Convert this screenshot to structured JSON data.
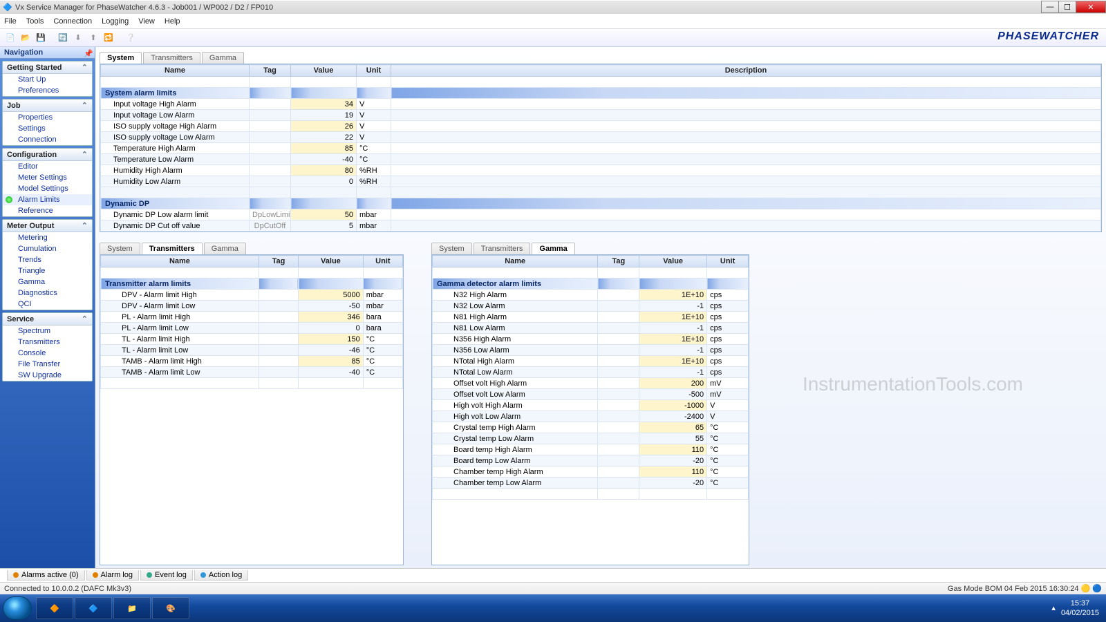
{
  "window": {
    "title": "Vx Service Manager for PhaseWatcher 4.6.3 - Job001 / WP002 / D2 / FP010"
  },
  "menu": [
    "File",
    "Tools",
    "Connection",
    "Logging",
    "View",
    "Help"
  ],
  "brand": "PHASEWATCHER",
  "nav": {
    "title": "Navigation",
    "panels": [
      {
        "title": "Getting Started",
        "items": [
          "Start Up",
          "Preferences"
        ]
      },
      {
        "title": "Job",
        "items": [
          "Properties",
          "Settings",
          "Connection"
        ]
      },
      {
        "title": "Configuration",
        "items": [
          "Editor",
          "Meter Settings",
          "Model Settings",
          "Alarm Limits",
          "Reference"
        ],
        "active": "Alarm Limits"
      },
      {
        "title": "Meter Output",
        "items": [
          "Metering",
          "Cumulation",
          "Trends",
          "Triangle",
          "Gamma",
          "Diagnostics",
          "QCI"
        ]
      },
      {
        "title": "Service",
        "items": [
          "Spectrum",
          "Transmitters",
          "Console",
          "File Transfer",
          "SW Upgrade"
        ]
      }
    ]
  },
  "grid_headers": [
    "Name",
    "Tag",
    "Value",
    "Unit",
    "Description"
  ],
  "grid_headers_short": [
    "Name",
    "Tag",
    "Value",
    "Unit"
  ],
  "top_tabs": [
    "System",
    "Transmitters",
    "Gamma"
  ],
  "top_active": "System",
  "system_table": {
    "sections": [
      {
        "title": "System alarm limits",
        "rows": [
          {
            "name": "Input voltage High Alarm",
            "tag": "",
            "value": "34",
            "unit": "V"
          },
          {
            "name": "Input voltage Low Alarm",
            "tag": "",
            "value": "19",
            "unit": "V"
          },
          {
            "name": "ISO supply voltage High Alarm",
            "tag": "",
            "value": "26",
            "unit": "V"
          },
          {
            "name": "ISO supply voltage Low Alarm",
            "tag": "",
            "value": "22",
            "unit": "V"
          },
          {
            "name": "Temperature High Alarm",
            "tag": "",
            "value": "85",
            "unit": "°C"
          },
          {
            "name": "Temperature Low Alarm",
            "tag": "",
            "value": "-40",
            "unit": "°C"
          },
          {
            "name": "Humidity High Alarm",
            "tag": "",
            "value": "80",
            "unit": "%RH"
          },
          {
            "name": "Humidity Low Alarm",
            "tag": "",
            "value": "0",
            "unit": "%RH"
          }
        ]
      },
      {
        "title": "Dynamic DP",
        "rows": [
          {
            "name": "Dynamic DP Low alarm limit",
            "tag": "DpLowLimit",
            "value": "50",
            "unit": "mbar"
          },
          {
            "name": "Dynamic DP Cut off value",
            "tag": "DpCutOff",
            "value": "5",
            "unit": "mbar"
          }
        ]
      }
    ]
  },
  "left_tabs": [
    "System",
    "Transmitters",
    "Gamma"
  ],
  "left_active": "Transmitters",
  "transmitter_table": {
    "title": "Transmitter alarm limits",
    "rows": [
      {
        "name": "DPV - Alarm limit High",
        "value": "5000",
        "unit": "mbar"
      },
      {
        "name": "DPV - Alarm limit Low",
        "value": "-50",
        "unit": "mbar"
      },
      {
        "name": "PL - Alarm limit High",
        "value": "346",
        "unit": "bara"
      },
      {
        "name": "PL - Alarm limit Low",
        "value": "0",
        "unit": "bara"
      },
      {
        "name": "TL - Alarm limit High",
        "value": "150",
        "unit": "°C"
      },
      {
        "name": "TL - Alarm limit Low",
        "value": "-46",
        "unit": "°C"
      },
      {
        "name": "TAMB - Alarm limit High",
        "value": "85",
        "unit": "°C"
      },
      {
        "name": "TAMB - Alarm limit Low",
        "value": "-40",
        "unit": "°C"
      }
    ]
  },
  "right_tabs": [
    "System",
    "Transmitters",
    "Gamma"
  ],
  "right_active": "Gamma",
  "gamma_table": {
    "title": "Gamma detector alarm limits",
    "rows": [
      {
        "name": "N32 High Alarm",
        "value": "1E+10",
        "unit": "cps"
      },
      {
        "name": "N32 Low Alarm",
        "value": "-1",
        "unit": "cps"
      },
      {
        "name": "N81 High Alarm",
        "value": "1E+10",
        "unit": "cps"
      },
      {
        "name": "N81 Low Alarm",
        "value": "-1",
        "unit": "cps"
      },
      {
        "name": "N356 High Alarm",
        "value": "1E+10",
        "unit": "cps"
      },
      {
        "name": "N356 Low Alarm",
        "value": "-1",
        "unit": "cps"
      },
      {
        "name": "NTotal High Alarm",
        "value": "1E+10",
        "unit": "cps"
      },
      {
        "name": "NTotal Low Alarm",
        "value": "-1",
        "unit": "cps"
      },
      {
        "name": "Offset volt High Alarm",
        "value": "200",
        "unit": "mV"
      },
      {
        "name": "Offset volt Low Alarm",
        "value": "-500",
        "unit": "mV"
      },
      {
        "name": "High volt High Alarm",
        "value": "-1000",
        "unit": "V"
      },
      {
        "name": "High volt Low Alarm",
        "value": "-2400",
        "unit": "V"
      },
      {
        "name": "Crystal temp High Alarm",
        "value": "65",
        "unit": "°C"
      },
      {
        "name": "Crystal temp Low Alarm",
        "value": "55",
        "unit": "°C"
      },
      {
        "name": "Board temp High Alarm",
        "value": "110",
        "unit": "°C"
      },
      {
        "name": "Board temp Low Alarm",
        "value": "-20",
        "unit": "°C"
      },
      {
        "name": "Chamber temp High Alarm",
        "value": "110",
        "unit": "°C"
      },
      {
        "name": "Chamber temp Low Alarm",
        "value": "-20",
        "unit": "°C"
      }
    ]
  },
  "bottom_tabs": [
    {
      "label": "Alarms active (0)",
      "color": "#e08000"
    },
    {
      "label": "Alarm log",
      "color": "#e08000"
    },
    {
      "label": "Event log",
      "color": "#3a8"
    },
    {
      "label": "Action log",
      "color": "#39d"
    }
  ],
  "status": {
    "left": "Connected to 10.0.0.2 (DAFC Mk3v3)",
    "right": "Gas Mode  BOM    04 Feb 2015 16:30:24"
  },
  "tray": {
    "time": "15:37",
    "date": "04/02/2015"
  },
  "watermark": "InstrumentationTools.com"
}
